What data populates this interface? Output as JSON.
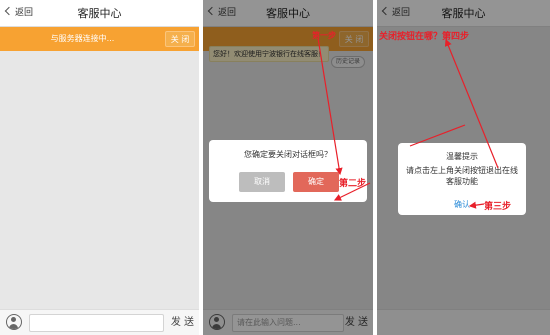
{
  "header": {
    "back_label": "返回",
    "title": "客服中心"
  },
  "banner": {
    "text": "与服务器连接中...",
    "close_label": "关 闭"
  },
  "footer": {
    "placeholder": "请在此输入问题...",
    "send_label": "发 送"
  },
  "chat": {
    "welcome": "您好！欢迎使用宁波银行在线客服！",
    "history_label": "历史记录"
  },
  "confirm_dialog": {
    "message": "您确定要关闭对话框吗？",
    "cancel_label": "取消",
    "ok_label": "确定"
  },
  "tip_dialog": {
    "title": "温馨提示",
    "line1": "请点击左上角关闭按钮退出在线",
    "line2": "客服功能",
    "confirm_label": "确认"
  },
  "annotations": {
    "step2": "第二步",
    "step3": "第三步",
    "step4": "关闭按钮在哪？第四步",
    "step1_partial": "第一步"
  },
  "colors": {
    "orange": "#f7a232",
    "red_annotation": "#e8202a",
    "ok_button": "#e2685a",
    "link_blue": "#2a8bd8"
  }
}
